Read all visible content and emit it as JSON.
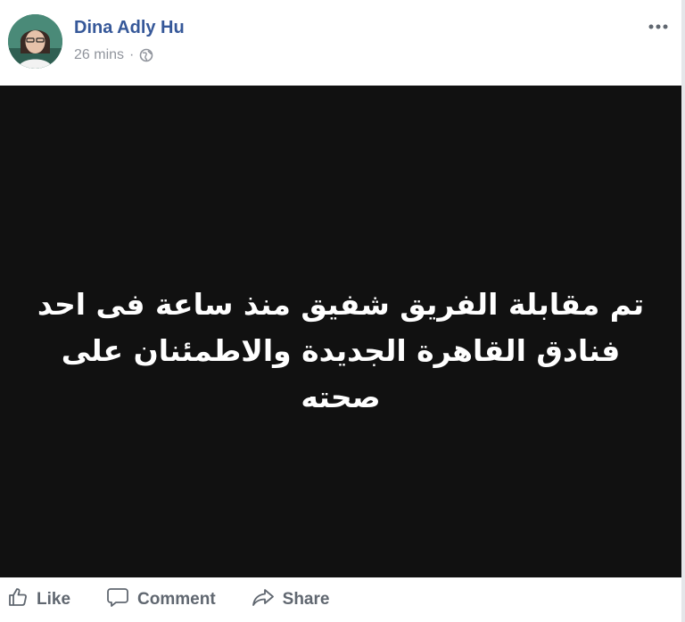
{
  "post": {
    "author": "Dina Adly Hu",
    "time": "26 mins",
    "separator": "·",
    "privacy_icon": "globe-icon",
    "more_icon": "more-options-icon",
    "image_text": "تم مقابلة الفريق شفيق منذ ساعة فى احد\nفنادق القاهرة الجديدة والاطمئنان على صحته",
    "colors": {
      "author_link": "#365899",
      "meta_text": "#90949c",
      "image_background": "#111111",
      "action_text": "#606770"
    }
  },
  "actions": {
    "like_label": "Like",
    "comment_label": "Comment",
    "share_label": "Share",
    "like_icon": "thumbs-up-icon",
    "comment_icon": "speech-bubble-icon",
    "share_icon": "share-arrow-icon"
  }
}
